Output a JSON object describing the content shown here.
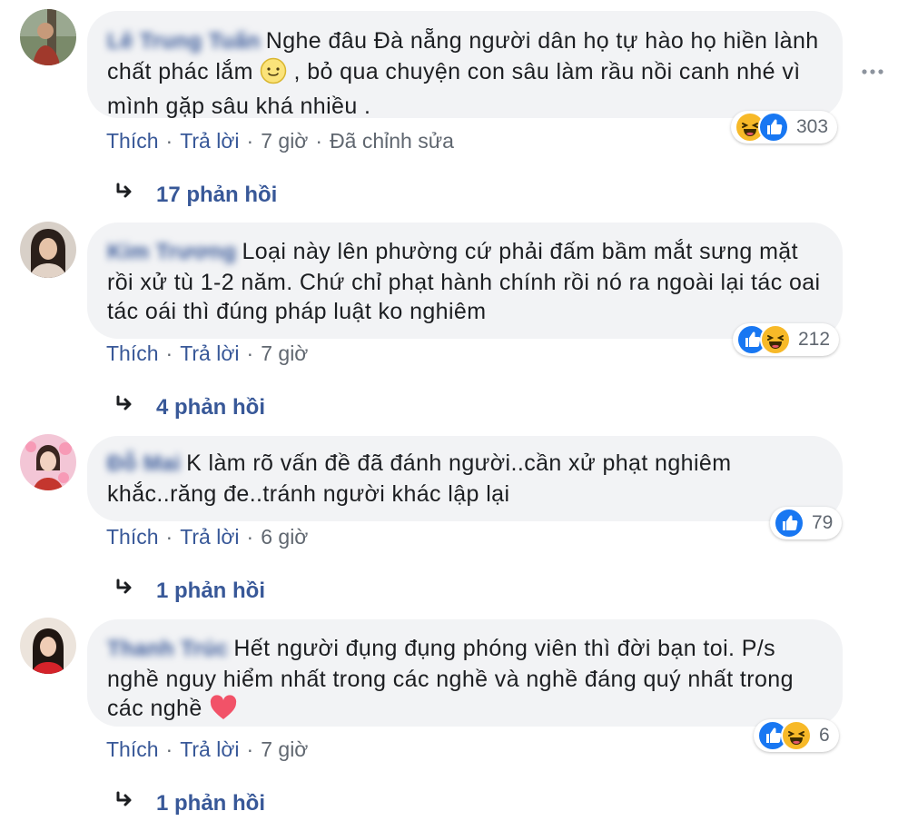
{
  "comments": [
    {
      "author": "Lê Trung Tuấn",
      "text_before": "Nghe đâu Đà nẵng người dân họ tự hào họ hiền lành chất phác lắm ",
      "text_after": " , bỏ qua chuyện con sâu làm rầu nồi canh nhé vì mình gặp sâu khá nhiều .",
      "reaction_count": "303",
      "like_label": "Thích",
      "reply_label": "Trả lời",
      "time": "7 giờ",
      "edited": "Đã chỉnh sửa",
      "replies": "17 phản hồi"
    },
    {
      "author": "Kim Trương",
      "text": "Loại này lên phường cứ phải đấm bầm mắt sưng mặt rồi xử tù 1-2 năm. Chứ chỉ phạt hành chính rồi nó ra ngoài lại tác oai tác oái thì đúng pháp luật ko nghiêm",
      "reaction_count": "212",
      "like_label": "Thích",
      "reply_label": "Trả lời",
      "time": "7 giờ",
      "replies": "4 phản hồi"
    },
    {
      "author": "Đỗ Mai",
      "text": "K làm rõ vấn đề đã đánh người..cần xử phạt nghiêm khắc..răng đe..tránh người khác lập lại",
      "reaction_count": "79",
      "like_label": "Thích",
      "reply_label": "Trả lời",
      "time": "6 giờ",
      "replies": "1 phản hồi"
    },
    {
      "author": "Thanh Trúc",
      "text": "Hết người đụng đụng phóng viên thì đời bạn toi. P/s nghề nguy hiểm nhất trong các nghề và nghề đáng quý nhất trong các nghề ",
      "reaction_count": "6",
      "like_label": "Thích",
      "reply_label": "Trả lời",
      "time": "7 giờ",
      "replies": "1 phản hồi"
    }
  ],
  "colors": {
    "link": "#385898",
    "bubble": "#f2f3f5",
    "muted": "#606770",
    "like_blue": "#1877f2",
    "haha_yellow": "#f7b928"
  },
  "icons": [
    "more-options-icon",
    "reply-arrow-icon",
    "like-reaction-icon",
    "haha-reaction-icon",
    "smile-emoji-icon",
    "heart-emoji-icon"
  ]
}
